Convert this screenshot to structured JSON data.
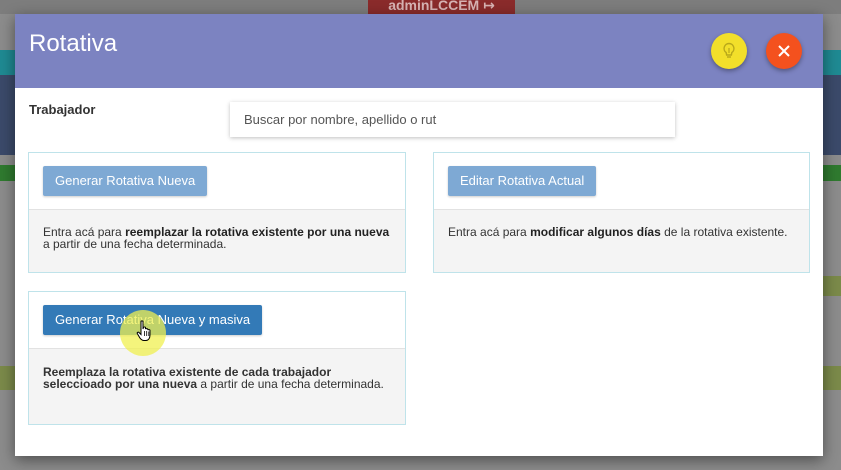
{
  "background": {
    "user_button": "adminLCCEM ↦"
  },
  "modal": {
    "title": "Rotativa",
    "hint_button_icon": "lightbulb-icon",
    "close_button_icon": "close-icon",
    "worker_label": "Trabajador",
    "search": {
      "placeholder": "Buscar por nombre, apellido o rut",
      "value": ""
    }
  },
  "cards": {
    "new": {
      "button": "Generar Rotativa Nueva",
      "text_pre": "Entra acá para ",
      "text_bold": "reemplazar la rotativa existente por una nueva",
      "text_post": " a partir de una fecha determinada."
    },
    "edit": {
      "button": "Editar Rotativa Actual",
      "text_pre": "Entra acá para ",
      "text_bold": "modificar algunos días",
      "text_post": " de la rotativa existente."
    },
    "mass": {
      "button": "Generar Rotativa Nueva y masiva",
      "text_bold": "Reemplaza la rotativa existente de cada trabajador seleccioado por una nueva",
      "text_post": " a partir de una fecha determinada."
    }
  },
  "colors": {
    "header": "#7c83c1",
    "hint_button": "#f2df2a",
    "close_button": "#f4511e",
    "primary_button": "#337ab7",
    "light_button": "#7ea9d4",
    "card_border": "#bfe3ea"
  }
}
